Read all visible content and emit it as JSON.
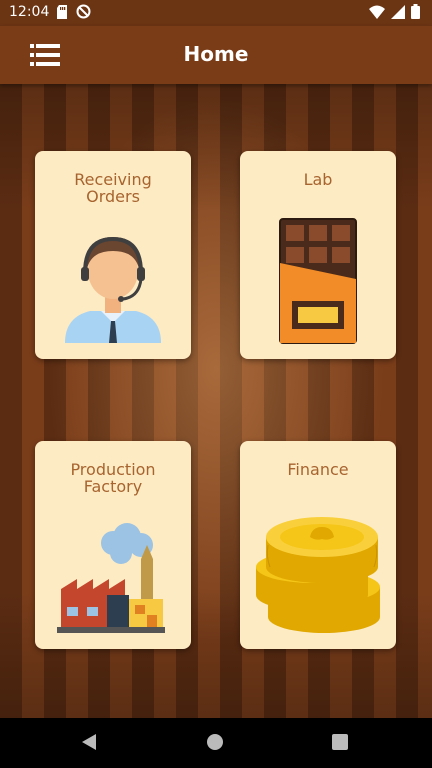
{
  "status_bar": {
    "time": "12:04",
    "icons": [
      "sd-card-icon",
      "no-disturb-icon",
      "wifi-icon",
      "signal-icon",
      "battery-icon"
    ]
  },
  "app_bar": {
    "title": "Home",
    "menu_icon": "menu-list-icon"
  },
  "cards": [
    {
      "label": "Receiving\nOrders",
      "icon": "customer-service-agent-icon"
    },
    {
      "label": "Lab",
      "icon": "chocolate-bar-icon"
    },
    {
      "label": "Production\nFactory",
      "icon": "factory-icon"
    },
    {
      "label": "Finance",
      "icon": "gold-coins-icon"
    }
  ],
  "nav_bar": {
    "back_icon": "back-icon",
    "home_icon": "home-icon",
    "recents_icon": "recents-icon"
  },
  "colors": {
    "app_bar": "#7a3b17",
    "status_bar": "#6b3413",
    "card": "#fdebc4",
    "card_label": "#a8642f"
  }
}
